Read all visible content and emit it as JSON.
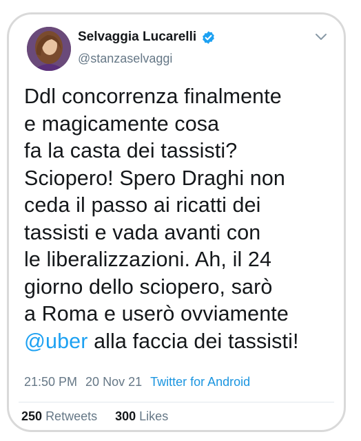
{
  "tweet": {
    "author": {
      "display_name": "Selvaggia Lucarelli",
      "handle": "@stanzaselvaggi",
      "verified": true
    },
    "text_lines": [
      "Ddl concorrenza finalmente",
      "e magicamente cosa",
      "fa la casta dei tassisti?",
      "Sciopero! Spero Draghi non",
      "ceda il passo ai ricatti dei",
      "tassisti e vada avanti con",
      "le liberalizzazioni. Ah, il 24",
      "giorno dello sciopero, sarò",
      "a Roma e userò ovviamente"
    ],
    "last_line": {
      "mention": "@uber",
      "rest": " alla faccia dei tassisti!"
    },
    "time": "21:50 PM",
    "date": "20 Nov 21",
    "source": "Twitter for Android",
    "retweets_count": "250",
    "retweets_label": "Retweets",
    "likes_count": "300",
    "likes_label": "Likes"
  },
  "icons": {
    "verified": "verified-badge-icon",
    "menu": "chevron-down-icon"
  },
  "colors": {
    "link": "#1da1f2",
    "text": "#14171a",
    "muted": "#657786",
    "frame": "#d9d9d9"
  }
}
